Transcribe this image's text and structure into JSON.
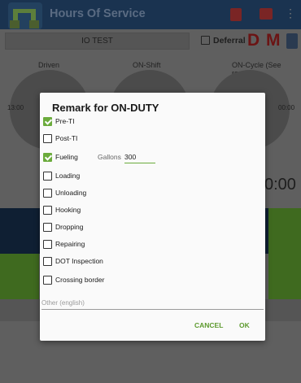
{
  "app": {
    "title": "Hours Of Service"
  },
  "subbar": {
    "driver": "IO TEST",
    "deferral_label": "Deferral",
    "dm_label": "D M"
  },
  "gauges": {
    "driven_label": "Driven",
    "onshift_label": "ON-Shift",
    "oncycle_label": "ON-Cycle (See recap)",
    "left_time": "13:00",
    "right_time": "00:00",
    "big_time": "0:00"
  },
  "dialog": {
    "title": "Remark for ON-DUTY",
    "options": [
      {
        "label": "Pre-TI",
        "checked": true
      },
      {
        "label": "Post-TI",
        "checked": false
      },
      {
        "label": "Fueling",
        "checked": true
      },
      {
        "label": "Loading",
        "checked": false
      },
      {
        "label": "Unloading",
        "checked": false
      },
      {
        "label": "Hooking",
        "checked": false
      },
      {
        "label": "Dropping",
        "checked": false
      },
      {
        "label": "Repairing",
        "checked": false
      },
      {
        "label": "DOT Inspection",
        "checked": false
      },
      {
        "label": "Crossing border",
        "checked": false
      }
    ],
    "gallons_label": "Gallons",
    "gallons_value": "300",
    "other_placeholder": "Other (english)",
    "cancel_label": "CANCEL",
    "ok_label": "OK"
  },
  "colors": {
    "accent": "#6bab3c",
    "button_text": "#5d9a2e",
    "app_bar": "#1a3350",
    "dm_red": "#c62828"
  },
  "icons": [
    "app-logo-icon",
    "alert-icon",
    "truck-icon",
    "more-vert-icon",
    "clipboard-icon"
  ]
}
